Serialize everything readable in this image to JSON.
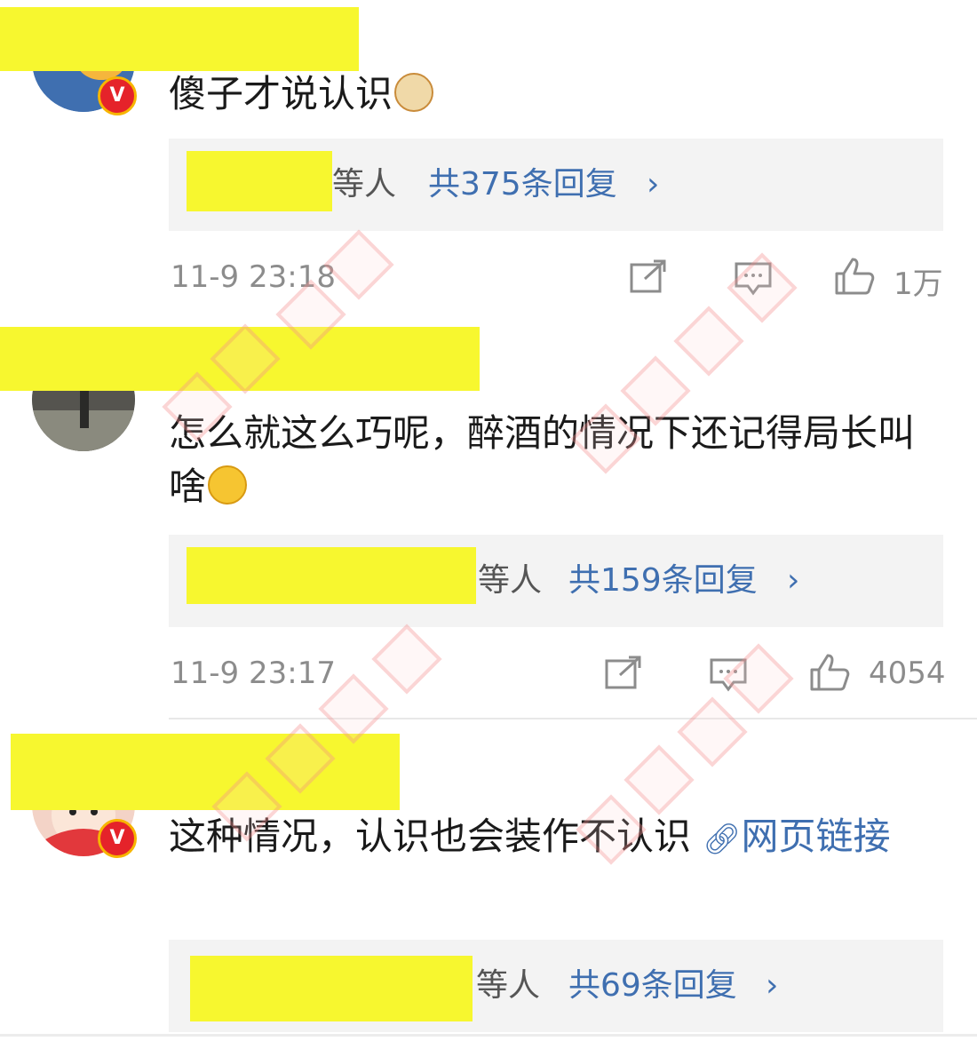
{
  "comments": [
    {
      "text": "傻子才说认识",
      "emoji": "cat-face",
      "reply": {
        "others": "等人",
        "count": "共375条回复",
        "chevron": "›"
      },
      "time": "11-9 23:18",
      "likes": "1万"
    },
    {
      "text": "怎么就这么巧呢，醉酒的情况下还记得局长叫啥",
      "emoji": "laughing-face",
      "reply": {
        "others": "等人",
        "count": "共159条回复",
        "chevron": "›"
      },
      "time": "11-9 23:17",
      "likes": "4054"
    },
    {
      "text": "这种情况，认识也会装作不认识",
      "link_label": "网页链接",
      "reply": {
        "others": "等人",
        "count": "共69条回复",
        "chevron": "›"
      }
    }
  ],
  "badge_letter": "V",
  "colors": {
    "link": "#3f6fb0",
    "meta": "#8c8c8c",
    "reply_bg": "#f3f3f3",
    "redaction": "#f7f72f",
    "badge_red": "#e5232a",
    "badge_ring": "#f7b500"
  },
  "icons": [
    "repost-icon",
    "comment-icon",
    "like-icon",
    "link-icon",
    "chevron-right-icon",
    "verified-badge-icon"
  ]
}
